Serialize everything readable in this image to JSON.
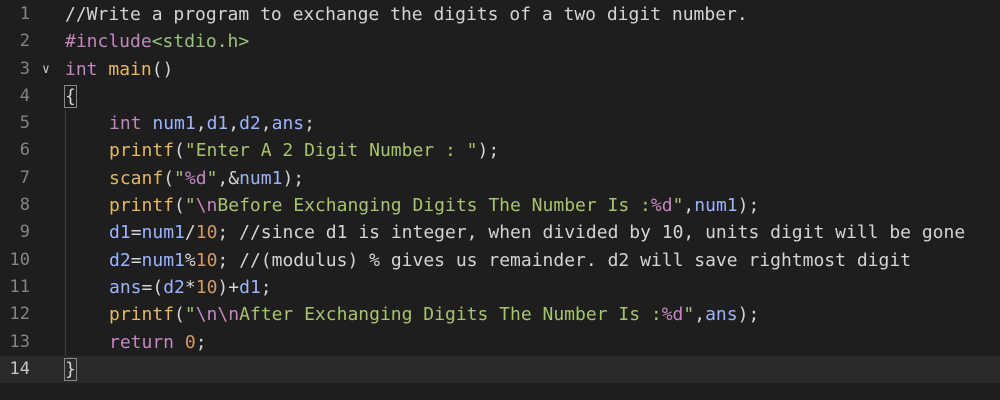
{
  "editor": {
    "lines": [
      {
        "num": "1",
        "fold": "",
        "indent": false,
        "tokens": [
          {
            "t": "c-comment",
            "v": "//Write a program to exchange the digits of a two digit number."
          }
        ]
      },
      {
        "num": "2",
        "fold": "",
        "indent": false,
        "tokens": [
          {
            "t": "c-pre",
            "v": "#include"
          },
          {
            "t": "c-inc",
            "v": "<stdio.h>"
          }
        ]
      },
      {
        "num": "3",
        "fold": "chevron-down",
        "indent": false,
        "tokens": [
          {
            "t": "c-type",
            "v": "int"
          },
          {
            "t": "c-op",
            "v": " "
          },
          {
            "t": "c-fn",
            "v": "main"
          },
          {
            "t": "c-op",
            "v": "()"
          }
        ]
      },
      {
        "num": "4",
        "fold": "",
        "indent": false,
        "tokens": [
          {
            "t": "c-op bracket-box",
            "v": "{"
          }
        ]
      },
      {
        "num": "5",
        "fold": "",
        "indent": true,
        "tokens": [
          {
            "t": "c-type",
            "v": "int"
          },
          {
            "t": "c-op",
            "v": " "
          },
          {
            "t": "c-var",
            "v": "num1"
          },
          {
            "t": "c-op",
            "v": ","
          },
          {
            "t": "c-var",
            "v": "d1"
          },
          {
            "t": "c-op",
            "v": ","
          },
          {
            "t": "c-var",
            "v": "d2"
          },
          {
            "t": "c-op",
            "v": ","
          },
          {
            "t": "c-var",
            "v": "ans"
          },
          {
            "t": "c-op",
            "v": ";"
          }
        ]
      },
      {
        "num": "6",
        "fold": "",
        "indent": true,
        "tokens": [
          {
            "t": "c-fn",
            "v": "printf"
          },
          {
            "t": "c-op",
            "v": "("
          },
          {
            "t": "c-str",
            "v": "\"Enter A 2 Digit Number : \""
          },
          {
            "t": "c-op",
            "v": ");"
          }
        ]
      },
      {
        "num": "7",
        "fold": "",
        "indent": true,
        "tokens": [
          {
            "t": "c-fn",
            "v": "scanf"
          },
          {
            "t": "c-op",
            "v": "("
          },
          {
            "t": "c-str",
            "v": "\""
          },
          {
            "t": "c-fmt",
            "v": "%d"
          },
          {
            "t": "c-str",
            "v": "\""
          },
          {
            "t": "c-op",
            "v": ",&"
          },
          {
            "t": "c-var",
            "v": "num1"
          },
          {
            "t": "c-op",
            "v": ");"
          }
        ]
      },
      {
        "num": "8",
        "fold": "",
        "indent": true,
        "tokens": [
          {
            "t": "c-fn",
            "v": "printf"
          },
          {
            "t": "c-op",
            "v": "("
          },
          {
            "t": "c-str",
            "v": "\""
          },
          {
            "t": "c-esc",
            "v": "\\n"
          },
          {
            "t": "c-str",
            "v": "Before Exchanging Digits The Number Is :"
          },
          {
            "t": "c-fmt",
            "v": "%d"
          },
          {
            "t": "c-str",
            "v": "\""
          },
          {
            "t": "c-op",
            "v": ","
          },
          {
            "t": "c-var",
            "v": "num1"
          },
          {
            "t": "c-op",
            "v": ");"
          }
        ]
      },
      {
        "num": "9",
        "fold": "",
        "indent": true,
        "tokens": [
          {
            "t": "c-var",
            "v": "d1"
          },
          {
            "t": "c-op",
            "v": "="
          },
          {
            "t": "c-var",
            "v": "num1"
          },
          {
            "t": "c-op",
            "v": "/"
          },
          {
            "t": "c-num",
            "v": "10"
          },
          {
            "t": "c-op",
            "v": "; "
          },
          {
            "t": "c-comment",
            "v": "//since d1 is integer, when divided by 10, units digit will be gone"
          }
        ]
      },
      {
        "num": "10",
        "fold": "",
        "indent": true,
        "tokens": [
          {
            "t": "c-var",
            "v": "d2"
          },
          {
            "t": "c-op",
            "v": "="
          },
          {
            "t": "c-var",
            "v": "num1"
          },
          {
            "t": "c-op",
            "v": "%"
          },
          {
            "t": "c-num",
            "v": "10"
          },
          {
            "t": "c-op",
            "v": "; "
          },
          {
            "t": "c-comment",
            "v": "//(modulus) % gives us remainder. d2 will save rightmost digit"
          }
        ]
      },
      {
        "num": "11",
        "fold": "",
        "indent": true,
        "tokens": [
          {
            "t": "c-var",
            "v": "ans"
          },
          {
            "t": "c-op",
            "v": "=("
          },
          {
            "t": "c-var",
            "v": "d2"
          },
          {
            "t": "c-op",
            "v": "*"
          },
          {
            "t": "c-num",
            "v": "10"
          },
          {
            "t": "c-op",
            "v": ")+"
          },
          {
            "t": "c-var",
            "v": "d1"
          },
          {
            "t": "c-op",
            "v": ";"
          }
        ]
      },
      {
        "num": "12",
        "fold": "",
        "indent": true,
        "tokens": [
          {
            "t": "c-fn",
            "v": "printf"
          },
          {
            "t": "c-op",
            "v": "("
          },
          {
            "t": "c-str",
            "v": "\""
          },
          {
            "t": "c-esc",
            "v": "\\n\\n"
          },
          {
            "t": "c-str",
            "v": "After Exchanging Digits The Number Is :"
          },
          {
            "t": "c-fmt",
            "v": "%d"
          },
          {
            "t": "c-str",
            "v": "\""
          },
          {
            "t": "c-op",
            "v": ","
          },
          {
            "t": "c-var",
            "v": "ans"
          },
          {
            "t": "c-op",
            "v": ");"
          }
        ]
      },
      {
        "num": "13",
        "fold": "",
        "indent": true,
        "tokens": [
          {
            "t": "c-kw",
            "v": "return"
          },
          {
            "t": "c-op",
            "v": " "
          },
          {
            "t": "c-num",
            "v": "0"
          },
          {
            "t": "c-op",
            "v": ";"
          }
        ]
      },
      {
        "num": "14",
        "fold": "",
        "indent": false,
        "current": true,
        "tokens": [
          {
            "t": "c-op bracket-box",
            "v": "}"
          }
        ]
      }
    ]
  }
}
